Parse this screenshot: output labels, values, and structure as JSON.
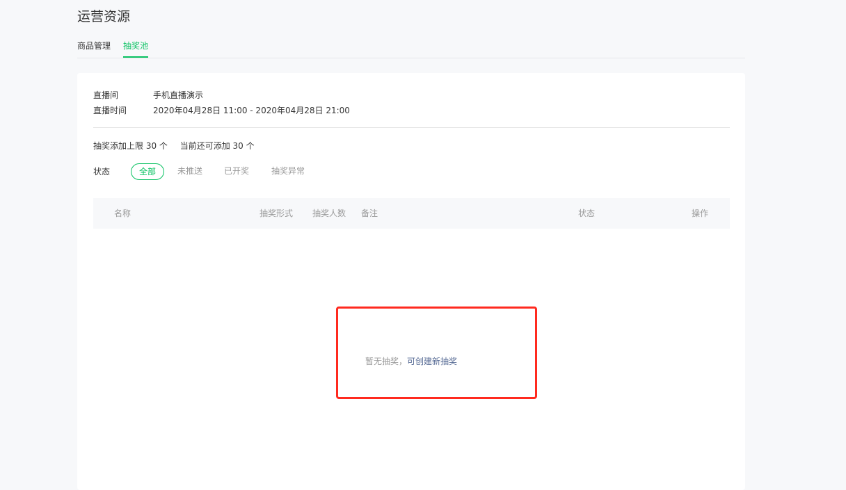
{
  "page": {
    "title": "运营资源"
  },
  "tabs": [
    {
      "label": "商品管理",
      "active": false
    },
    {
      "label": "抽奖池",
      "active": true
    }
  ],
  "live": {
    "room_label": "直播间",
    "room_value": "手机直播演示",
    "time_label": "直播时间",
    "time_value": "2020年04月28日 11:00 - 2020年04月28日 21:00"
  },
  "limits": {
    "max_text": "抽奖添加上限 30 个",
    "remaining_text": "当前还可添加 30 个"
  },
  "status_filter": {
    "label": "状态",
    "options": [
      {
        "label": "全部",
        "active": true
      },
      {
        "label": "未推送",
        "active": false
      },
      {
        "label": "已开奖",
        "active": false
      },
      {
        "label": "抽奖异常",
        "active": false
      }
    ]
  },
  "table": {
    "columns": [
      "名称",
      "抽奖形式",
      "抽奖人数",
      "备注",
      "状态",
      "操作"
    ]
  },
  "empty_state": {
    "message": "暂无抽奖，",
    "link": "可创建新抽奖"
  },
  "colors": {
    "accent": "#07c160",
    "link": "#576b95",
    "highlight": "#ff2a1f"
  }
}
